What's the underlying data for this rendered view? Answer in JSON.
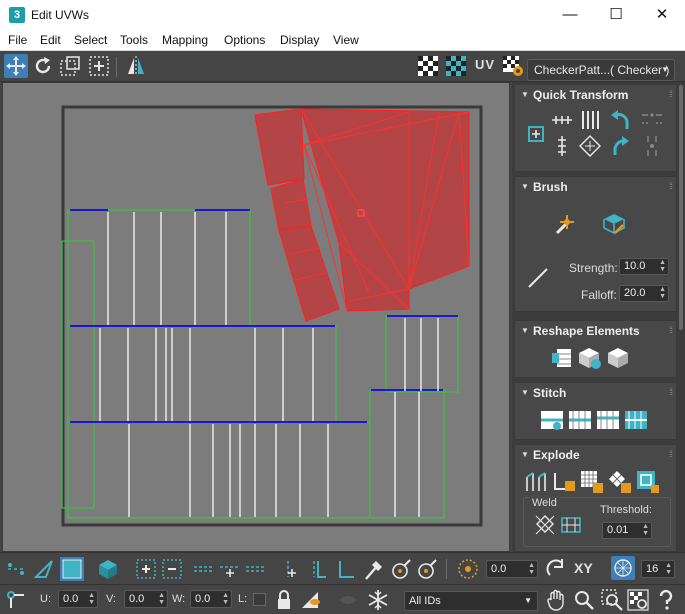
{
  "window": {
    "title": "Edit UVWs",
    "app_icon": "3",
    "minimize": "—",
    "maximize": "☐",
    "close": "✕"
  },
  "menu": [
    "File",
    "Edit",
    "Select",
    "Tools",
    "Mapping",
    "Options",
    "Display",
    "View"
  ],
  "toolbar": {
    "uv_label": "UV",
    "checker_dropdown": "CheckerPatt...( Checker )"
  },
  "panel": {
    "quick_transform": {
      "title": "Quick Transform"
    },
    "brush": {
      "title": "Brush",
      "strength_label": "Strength:",
      "strength_value": "10.0",
      "falloff_label": "Falloff:",
      "falloff_value": "20.0"
    },
    "reshape": {
      "title": "Reshape Elements"
    },
    "stitch": {
      "title": "Stitch"
    },
    "explode": {
      "title": "Explode",
      "weld_label": "Weld",
      "threshold_label": "Threshold:",
      "threshold_value": "0.01"
    }
  },
  "bottom": {
    "rotation_value": "0.0",
    "xy_label": "XY",
    "grid_value": "16",
    "u_label": "U:",
    "u_value": "0.0",
    "v_label": "V:",
    "v_value": "0.0",
    "w_label": "W:",
    "w_value": "0.0",
    "l_label": "L:",
    "id_filter": "All IDs"
  },
  "colors": {
    "accent": "#3fb4c4",
    "selected_fill": "#c0393b",
    "selected_edge": "#ff2020",
    "island_green": "#33cc33",
    "seam_blue": "#1a1acc"
  }
}
